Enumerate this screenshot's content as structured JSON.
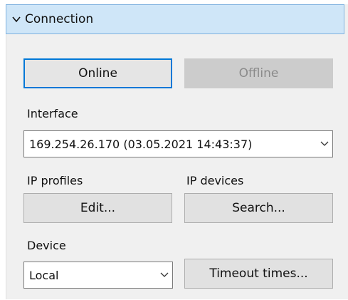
{
  "connection": {
    "title": "Connection",
    "online_label": "Online",
    "offline_label": "Offline",
    "interface_label": "Interface",
    "interface_value": "169.254.26.170 (03.05.2021 14:43:37)",
    "ip_profiles_label": "IP profiles",
    "ip_devices_label": "IP devices",
    "edit_label": "Edit...",
    "search_label": "Search...",
    "device_label": "Device",
    "device_value": "Local",
    "timeout_label": "Timeout times..."
  },
  "icons": {
    "collapse": "chevron-down-icon",
    "dropdown": "chevron-down-icon"
  },
  "colors": {
    "header_bg": "#cfe6f8",
    "header_border": "#7fb2df",
    "focus_border": "#0078d7",
    "panel_bg": "#f0f0f0"
  }
}
